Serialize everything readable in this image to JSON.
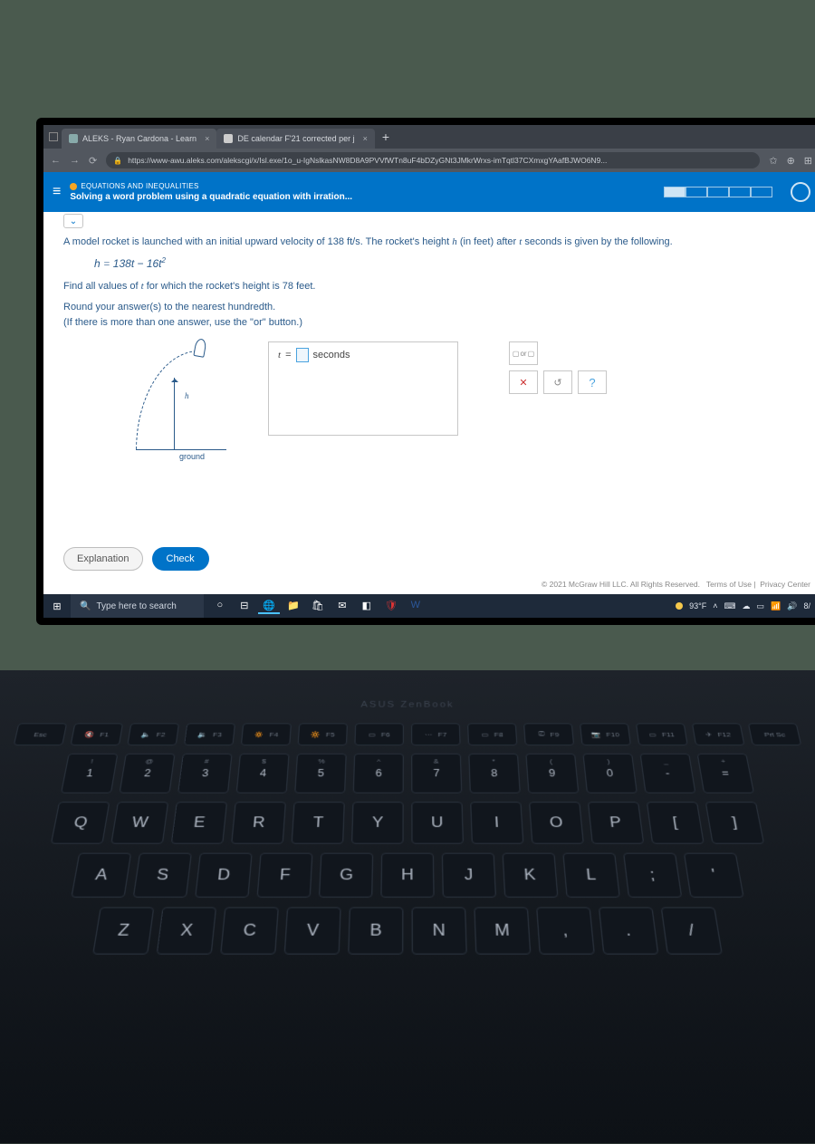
{
  "browser": {
    "tabs": [
      {
        "title": "ALEKS - Ryan Cardona - Learn",
        "active": true
      },
      {
        "title": "DE calendar F'21 corrected per j",
        "active": false
      }
    ],
    "new_tab": "+",
    "url": "https://www-awu.aleks.com/alekscgi/x/Isl.exe/1o_u-IgNslkasNW8D8A9PVVfWTn8uF4bDZyGNt3JMkrWrxs-imTqtl37CXmxgYAafBJWO6N9..."
  },
  "aleks": {
    "category": "EQUATIONS AND INEQUALITIES",
    "topic": "Solving a word problem using a quadratic equation with irration..."
  },
  "problem": {
    "intro_a": "A model rocket is launched with an initial upward velocity of 138 ft/s. The rocket's height ",
    "intro_var": "h",
    "intro_b": " (in feet) after ",
    "intro_tvar": "t",
    "intro_c": " seconds is given by the following.",
    "equation_lhs": "h",
    "equation_rhs": "138t − 16t",
    "equation_exp": "2",
    "find": "Find all values of ",
    "find_var": "t",
    "find_b": " for which the rocket's height is 78 feet.",
    "round_a": "Round your answer(s) to the nearest hundredth.",
    "round_b": "(If there is more than one answer, use the \"or\" button.)",
    "diagram": {
      "h_label": "h",
      "ground_label": "ground"
    },
    "answer": {
      "var": "t",
      "eq": "=",
      "unit": "seconds"
    },
    "tools": {
      "or": "or",
      "x_label": "✕",
      "reset": "↺",
      "help": "?"
    },
    "buttons": {
      "explanation": "Explanation",
      "check": "Check"
    },
    "footer": {
      "copyright": "© 2021 McGraw Hill LLC. All Rights Reserved.",
      "terms": "Terms of Use",
      "privacy": "Privacy Center"
    }
  },
  "taskbar": {
    "search_placeholder": "Type here to search",
    "weather": "93°F"
  },
  "keyboard": {
    "brand": "ASUS ZenBook",
    "fn_row": [
      "Esc",
      "F1",
      "F2",
      "F3",
      "F4",
      "F5",
      "F6",
      "F7",
      "F8",
      "F9",
      "F10",
      "F11",
      "F12",
      "Prt Sc"
    ],
    "fn_icons": [
      "",
      "🔇",
      "🔈",
      "🔉",
      "🔅",
      "🔆",
      "▭",
      "⋯",
      "▭",
      "⎚",
      "📷",
      "▭",
      "✈",
      ""
    ],
    "num_row": [
      {
        "u": "!",
        "l": "1"
      },
      {
        "u": "@",
        "l": "2"
      },
      {
        "u": "#",
        "l": "3"
      },
      {
        "u": "$",
        "l": "4"
      },
      {
        "u": "%",
        "l": "5"
      },
      {
        "u": "^",
        "l": "6"
      },
      {
        "u": "&",
        "l": "7"
      },
      {
        "u": "*",
        "l": "8"
      },
      {
        "u": "(",
        "l": "9"
      },
      {
        "u": ")",
        "l": "0"
      },
      {
        "u": "_",
        "l": "-"
      },
      {
        "u": "+",
        "l": "="
      }
    ],
    "row_q": [
      "Q",
      "W",
      "E",
      "R",
      "T",
      "Y",
      "U",
      "I",
      "O",
      "P",
      "[",
      "]"
    ],
    "row_a": [
      "A",
      "S",
      "D",
      "F",
      "G",
      "H",
      "J",
      "K",
      "L",
      ";",
      "'"
    ],
    "row_z": [
      "Z",
      "X",
      "C",
      "V",
      "B",
      "N",
      "M",
      ",",
      ".",
      "/"
    ]
  }
}
